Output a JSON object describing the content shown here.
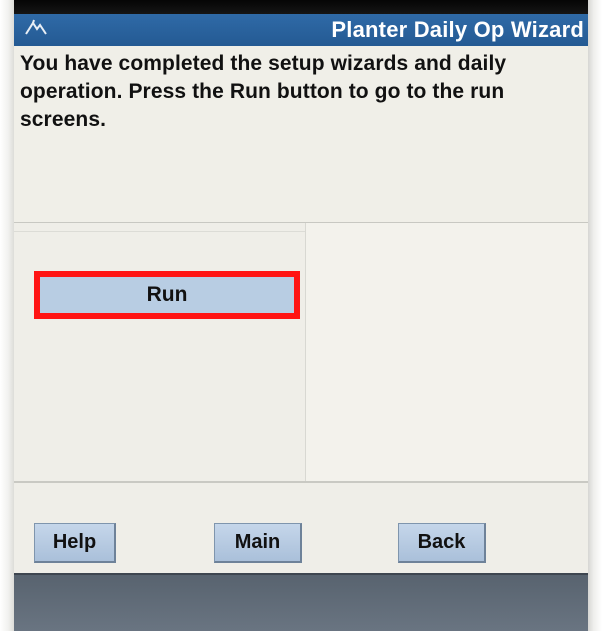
{
  "title_bar": {
    "title": "Planter Daily Op Wizard",
    "icon": "planter-app-icon",
    "color": "#2f6aa7"
  },
  "message": {
    "text": "You have completed the setup wizards and daily operation. Press the Run button to go to the run screens."
  },
  "action": {
    "run_label": "Run",
    "highlight_color": "#ff1414",
    "button_color": "#b8cde3"
  },
  "nav": {
    "help_label": "Help",
    "main_label": "Main",
    "back_label": "Back"
  }
}
